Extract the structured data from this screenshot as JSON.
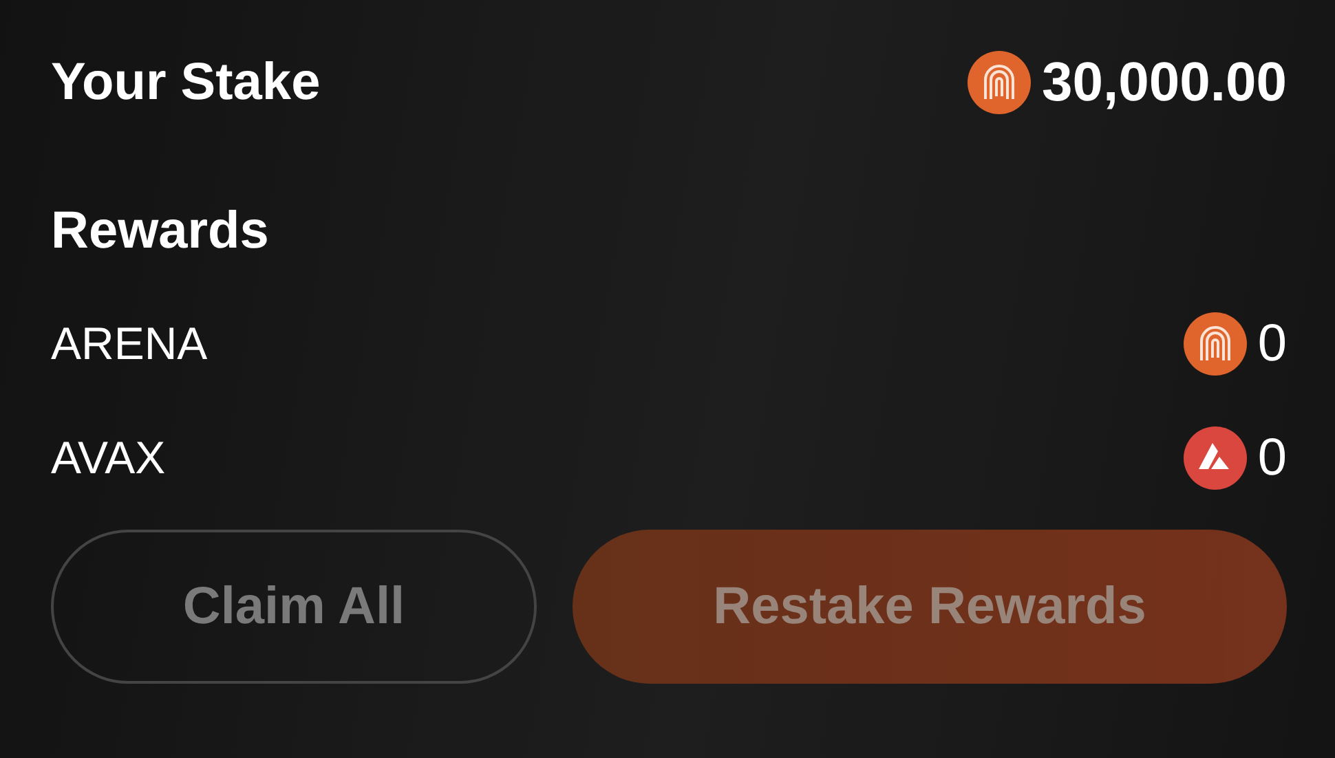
{
  "stake": {
    "label": "Your Stake",
    "kind": "arena",
    "amount": "30,000.00"
  },
  "rewards": {
    "title": "Rewards",
    "items": [
      {
        "name": "ARENA",
        "kind": "arena",
        "amount": "0"
      },
      {
        "name": "AVAX",
        "kind": "avax",
        "amount": "0"
      }
    ]
  },
  "buttons": [
    {
      "label": "Claim All",
      "kind": "outline",
      "disabled": true
    },
    {
      "label": "Restake Rewards",
      "kind": "primary",
      "disabled": true
    }
  ]
}
